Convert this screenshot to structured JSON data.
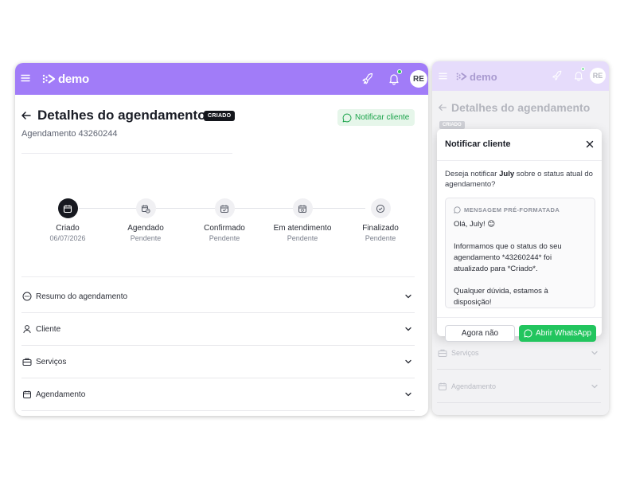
{
  "brand": {
    "name": "demo",
    "accent": "#a17cf8",
    "accent_faded": "#e6dcfb",
    "whatsapp_green": "#22c55e"
  },
  "header": {
    "user_initials": "RE",
    "icons": [
      "menu-icon",
      "rocket-icon",
      "bell-icon"
    ]
  },
  "page": {
    "title": "Detalhes do agendamento",
    "status_tag": "CRIADO",
    "subtitle": "Agendamento 43260244",
    "notify_button": "Notificar cliente"
  },
  "steps": [
    {
      "label": "Criado",
      "sub": "06/07/2026",
      "active": true,
      "icon": "calendar-icon"
    },
    {
      "label": "Agendado",
      "sub": "Pendente",
      "active": false,
      "icon": "calendar-clock-icon"
    },
    {
      "label": "Confirmado",
      "sub": "Pendente",
      "active": false,
      "icon": "calendar-check-icon"
    },
    {
      "label": "Em atendimento",
      "sub": "Pendente",
      "active": false,
      "icon": "calendar-sync-icon"
    },
    {
      "label": "Finalizado",
      "sub": "Pendente",
      "active": false,
      "icon": "check-circle-icon"
    }
  ],
  "accordion": [
    {
      "label": "Resumo do agendamento",
      "icon": "dots-circle-icon"
    },
    {
      "label": "Cliente",
      "icon": "user-icon"
    },
    {
      "label": "Serviços",
      "icon": "briefcase-icon"
    },
    {
      "label": "Agendamento",
      "icon": "calendar-icon"
    }
  ],
  "right_background": {
    "title": "Detalhes do agendamento",
    "status_tag": "CRIADO",
    "accordion": [
      {
        "label": "Serviços"
      },
      {
        "label": "Agendamento"
      }
    ]
  },
  "modal": {
    "title": "Notificar cliente",
    "question_prefix": "Deseja notificar ",
    "client_name": "July",
    "question_suffix": " sobre o status atual do agendamento?",
    "message_header": "MENSAGEM PRÉ-FORMATADA",
    "message_lines": [
      "Olá, July! 😊",
      "Informamos que o status do seu agendamento *43260244* foi atualizado para *Criado*.",
      "Qualquer dúvida, estamos à disposição!"
    ],
    "cancel_button": "Agora não",
    "confirm_button": "Abrir WhatsApp"
  }
}
